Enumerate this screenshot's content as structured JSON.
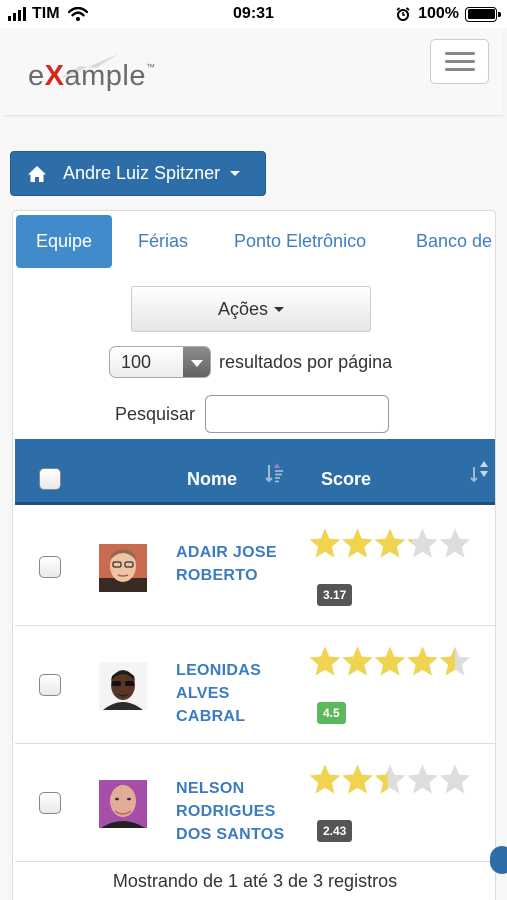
{
  "status_bar": {
    "carrier": "TIM",
    "time": "09:31",
    "battery": "100%"
  },
  "navbar": {
    "logo_prefix": "e",
    "logo_x": "X",
    "logo_rest": "ample",
    "logo_tm": "™"
  },
  "user_menu": {
    "label": "Andre Luiz Spitzner"
  },
  "tabs": [
    {
      "label": "Equipe",
      "active": true
    },
    {
      "label": "Férias",
      "active": false
    },
    {
      "label": "Ponto Eletrônico",
      "active": false
    },
    {
      "label": "Banco de",
      "active": false
    }
  ],
  "actions": {
    "label": "Ações"
  },
  "page_length": {
    "value": "100",
    "label": "resultados por página"
  },
  "search": {
    "label": "Pesquisar",
    "value": ""
  },
  "table": {
    "columns": {
      "name": "Nome",
      "score": "Score"
    },
    "rows": [
      {
        "name": "ADAIR JOSE ROBERTO",
        "rating": 3.17,
        "badge": "3.17",
        "badge_color": "#555555"
      },
      {
        "name": "LEONIDAS ALVES CABRAL",
        "rating": 4.5,
        "badge": "4.5",
        "badge_color": "#5cb85c"
      },
      {
        "name": "NELSON RODRIGUES DOS SANTOS",
        "rating": 2.43,
        "badge": "2.43",
        "badge_color": "#555555"
      }
    ]
  },
  "footer": {
    "info": "Mostrando de 1 até 3 de 3 registros"
  },
  "colors": {
    "primary": "#2d6ea8",
    "tab_active": "#428bca",
    "link": "#3b7cc0",
    "star": "#f0d34e",
    "star_empty": "#dddddd"
  }
}
